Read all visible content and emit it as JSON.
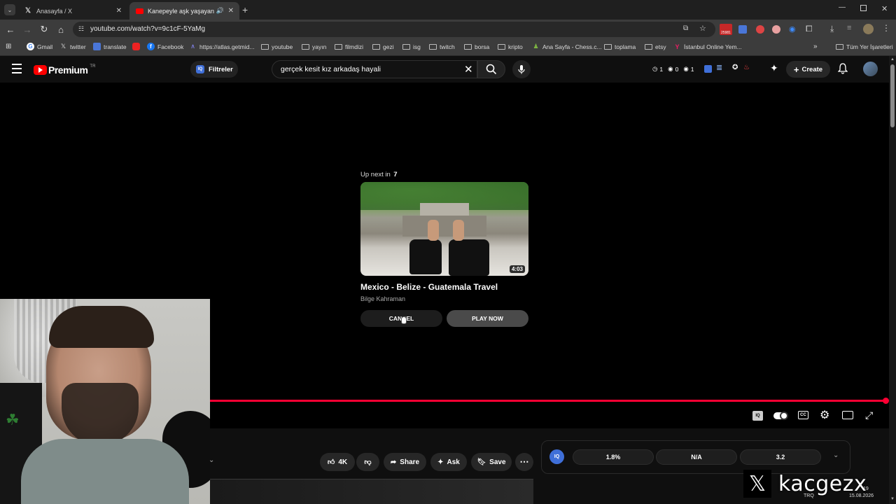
{
  "tabs": [
    {
      "title": "Anasayfa / X"
    },
    {
      "title": "Kanepeyle aşk yaşayan Sar"
    }
  ],
  "toolbar": {
    "url": "youtube.com/watch?v=9c1cF-5YaMg"
  },
  "bookmarks": [
    "Gmail",
    "twitter",
    "translate",
    "Facebook",
    "https://atlas.getmid...",
    "youtube",
    "yayın",
    "filmdizi",
    "gezi",
    "isg",
    "twitch",
    "borsa",
    "kripto",
    "Ana Sayfa - Chess.c...",
    "toplama",
    "etsy",
    "İstanbul Online Yem...",
    "Tüm Yer İşaretleri"
  ],
  "ext_badge": "25981",
  "youtube": {
    "logo": "Premium",
    "logo_sup": "TR",
    "filters_label": "Filtreler",
    "search_value": "gerçek kesit kız arkadaş hayali",
    "counters": [
      "1",
      "0",
      "1"
    ],
    "create_label": "Create"
  },
  "upnext": {
    "prefix": "Up next in",
    "seconds": "7",
    "duration": "4:03",
    "title": "Mexico - Belize - Guatemala Travel",
    "channel": "Bilge Kahraman",
    "cancel_label": "CANCEL",
    "play_label": "PLAY NOW"
  },
  "player": {
    "progress": 1.0,
    "accent": "#ff0033"
  },
  "actions": {
    "likes": "4K",
    "share": "Share",
    "ask": "Ask",
    "save": "Save"
  },
  "metrics": [
    "1.8%",
    "N/A",
    "3.2"
  ],
  "watermark": "kacgezx",
  "tray": {
    "lang": "TRQ",
    "time": "19",
    "date": "15.08.2026"
  }
}
